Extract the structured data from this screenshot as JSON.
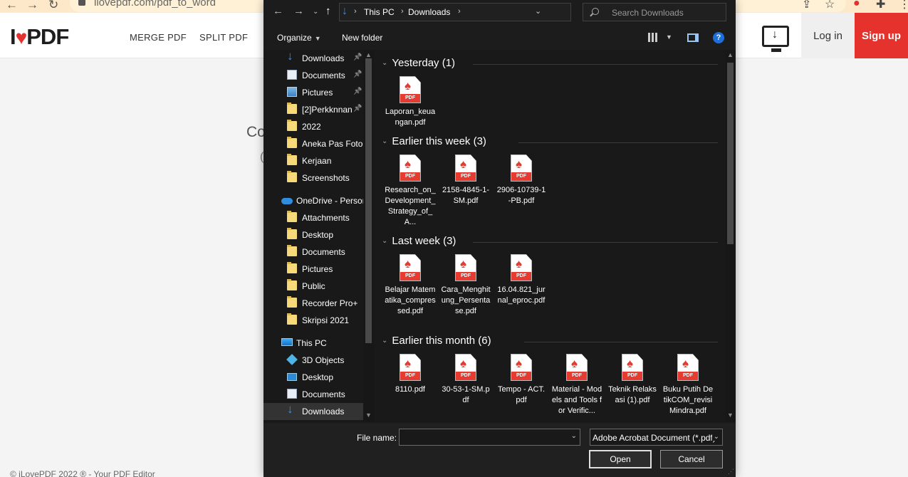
{
  "browser": {
    "url": "ilovepdf.com/pdf_to_word"
  },
  "site": {
    "logo_i": "I",
    "logo_pdf": "PDF",
    "nav": [
      "MERGE PDF",
      "SPLIT PDF"
    ],
    "login_label": "Log in",
    "signup_label": "Sign up",
    "partial_heading": "Co",
    "partial_text": "(",
    "footer": "© iLovePDF 2022 ® - Your PDF Editor",
    "accent_color": "#e5322d"
  },
  "dialog": {
    "address": {
      "crumbs": [
        "This PC",
        "Downloads"
      ],
      "search_placeholder": "Search Downloads"
    },
    "toolbar": {
      "organize_label": "Organize",
      "new_folder_label": "New folder"
    },
    "nav_items": [
      {
        "label": "Downloads",
        "icon": "download-icon",
        "pinned": true
      },
      {
        "label": "Documents",
        "icon": "document-icon",
        "pinned": true
      },
      {
        "label": "Pictures",
        "icon": "pictures-icon",
        "pinned": true
      },
      {
        "label": "[2]Perkknnan",
        "icon": "folder-icon",
        "pinned": true
      },
      {
        "label": "2022",
        "icon": "folder-icon",
        "pinned": false
      },
      {
        "label": "Aneka Pas Foto",
        "icon": "folder-icon",
        "pinned": false
      },
      {
        "label": "Kerjaan",
        "icon": "folder-icon",
        "pinned": false
      },
      {
        "label": "Screenshots",
        "icon": "folder-icon",
        "pinned": false
      },
      {
        "label": "OneDrive - Persor",
        "icon": "cloud-icon",
        "pinned": false
      },
      {
        "label": "Attachments",
        "icon": "folder-icon",
        "pinned": false
      },
      {
        "label": "Desktop",
        "icon": "folder-icon",
        "pinned": false
      },
      {
        "label": "Documents",
        "icon": "folder-icon",
        "pinned": false
      },
      {
        "label": "Pictures",
        "icon": "folder-icon",
        "pinned": false
      },
      {
        "label": "Public",
        "icon": "folder-icon",
        "pinned": false
      },
      {
        "label": "Recorder Pro+",
        "icon": "folder-icon",
        "pinned": false
      },
      {
        "label": "Skripsi 2021",
        "icon": "folder-icon",
        "pinned": false
      },
      {
        "label": "This PC",
        "icon": "computer-icon",
        "pinned": false
      },
      {
        "label": "3D Objects",
        "icon": "cube-icon",
        "pinned": false
      },
      {
        "label": "Desktop",
        "icon": "desktop-folder-icon",
        "pinned": false
      },
      {
        "label": "Documents",
        "icon": "document-icon",
        "pinned": false
      },
      {
        "label": "Downloads",
        "icon": "download-icon",
        "pinned": false,
        "selected": true
      }
    ],
    "groups": [
      {
        "title": "Yesterday (1)",
        "files": [
          "Laporan_keuangan.pdf"
        ]
      },
      {
        "title": "Earlier this week (3)",
        "files": [
          "Research_on_Development_Strategy_of_A...",
          "2158-4845-1-SM.pdf",
          "2906-10739-1-PB.pdf"
        ]
      },
      {
        "title": "Last week (3)",
        "files": [
          "Belajar Matematika_compressed.pdf",
          "Cara_Menghitung_Persentase.pdf",
          "16.04.821_jurnal_eproc.pdf"
        ]
      },
      {
        "title": "Earlier this month (6)",
        "files": [
          "8110.pdf",
          "30-53-1-SM.pdf",
          "Tempo - ACT.pdf",
          "Material - Models and Tools for Verific...",
          "Teknik Relaksasi (1).pdf",
          "Buku Putih DetikCOM_revisi Mindra.pdf"
        ]
      }
    ],
    "file_name_label": "File name:",
    "file_name_value": "",
    "file_type_value": "Adobe Acrobat Document (*.pdf)",
    "open_label": "Open",
    "cancel_label": "Cancel",
    "pdf_badge": "PDF"
  }
}
